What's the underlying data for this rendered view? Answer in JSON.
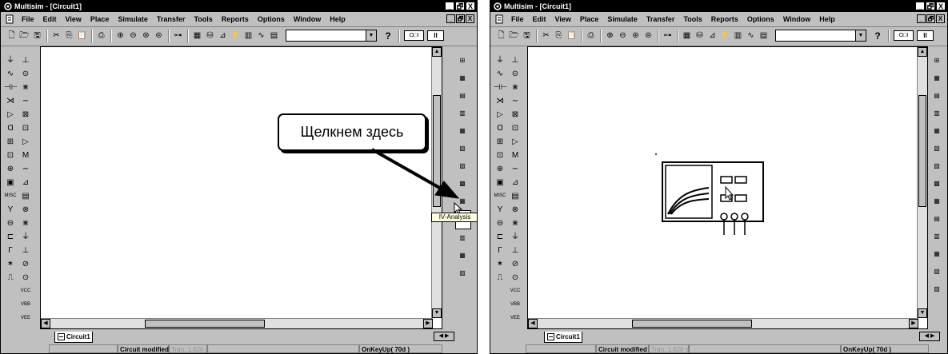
{
  "window": {
    "title": "Multisim - [Circuit1]",
    "caption_buttons": [
      "_",
      "🗗",
      "X"
    ],
    "mdi_buttons": [
      "_",
      "🗗",
      "X"
    ]
  },
  "menu": [
    "File",
    "Edit",
    "View",
    "Place",
    "Simulate",
    "Transfer",
    "Tools",
    "Reports",
    "Options",
    "Window",
    "Help"
  ],
  "toolbar": {
    "help_label": "?",
    "sim_switch_label": "O□I",
    "pause_label": "II"
  },
  "left_panel": {
    "source_icons": [
      "⏚",
      "∿",
      "⊣⊢",
      "⋊",
      "▷",
      "Ɑ",
      "⊞",
      "⊡",
      "⊕",
      "▣",
      "MISC",
      "Y",
      "⊖",
      "⊏",
      "Γ",
      "✶",
      "⎍"
    ],
    "virtual_icons": [
      "⊥",
      "⊝",
      "⋇",
      "∼",
      "⊠",
      "⊡",
      "▷",
      "M",
      "∼",
      "⊿",
      "▤",
      "⊗",
      "⋇",
      "⏚",
      "⊥",
      "⊘",
      "⊙",
      "VCC",
      "VBB",
      "VEE"
    ]
  },
  "right_panel": {
    "icons": [
      "⊞",
      "▦",
      "▤",
      "▥",
      "▦",
      "▧",
      "▨",
      "▩",
      "▦",
      "▤",
      "▥",
      "▦",
      "▧",
      "▨",
      "▩",
      "▦",
      "▤",
      "▥"
    ]
  },
  "status": {
    "modified": "Circuit modified",
    "tran": "Tran: 1.620 s",
    "event": "OnKeyUp( 70d )"
  },
  "tab_label": "Circuit1",
  "callout_text": "Щелкнем здесь",
  "tooltip_text": "IV-Analysis"
}
